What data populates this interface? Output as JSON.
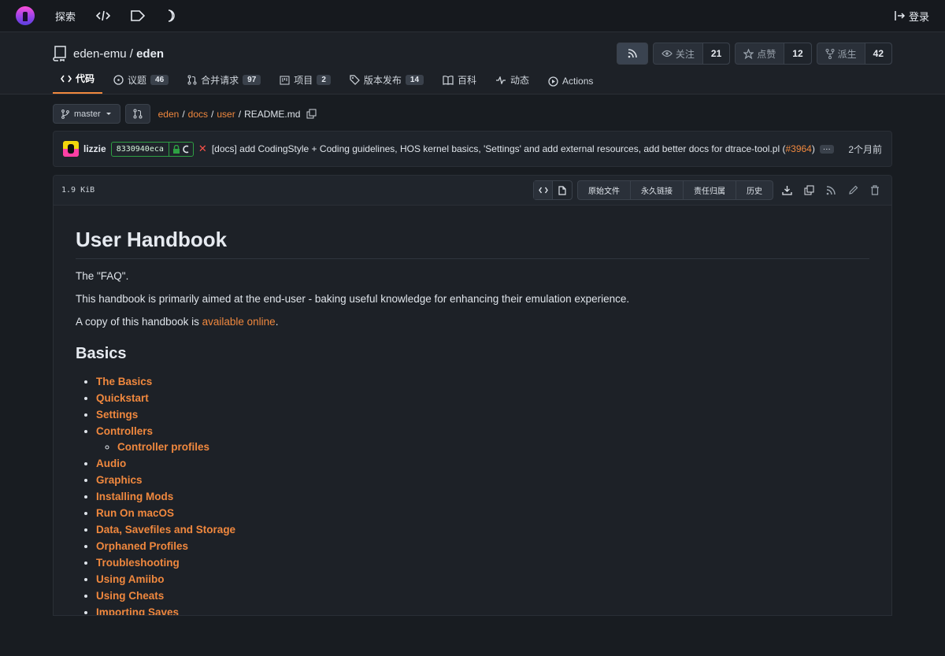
{
  "topnav": {
    "explore": "探索",
    "login": "登录"
  },
  "repo": {
    "owner": "eden-emu",
    "separator": "/",
    "name": "eden",
    "watch_label": "关注",
    "watch_count": "21",
    "star_label": "点赞",
    "star_count": "12",
    "fork_label": "派生",
    "fork_count": "42"
  },
  "tabs": [
    {
      "label": "代码",
      "badge": ""
    },
    {
      "label": "议题",
      "badge": "46"
    },
    {
      "label": "合并请求",
      "badge": "97"
    },
    {
      "label": "项目",
      "badge": "2"
    },
    {
      "label": "版本发布",
      "badge": "14"
    },
    {
      "label": "百科",
      "badge": ""
    },
    {
      "label": "动态",
      "badge": ""
    },
    {
      "label": "Actions",
      "badge": ""
    }
  ],
  "breadcrumb": {
    "branch": "master",
    "parts": [
      "eden",
      "docs",
      "user"
    ],
    "file": "README.md"
  },
  "commit": {
    "author": "lizzie",
    "sha": "8330940eca",
    "message": "[docs] add CodingStyle + Coding guidelines, HOS kernel basics, 'Settings' and add external resources, add better docs for dtrace-tool.pl (",
    "pr": "#3964",
    "message_end": ")",
    "ellipsis": "···",
    "time": "2个月前"
  },
  "file": {
    "size": "1.9 KiB",
    "buttons": [
      "原始文件",
      "永久链接",
      "责任归属",
      "历史"
    ]
  },
  "markdown": {
    "title": "User Handbook",
    "p1": "The \"FAQ\".",
    "p2": "This handbook is primarily aimed at the end-user - baking useful knowledge for enhancing their emulation experience.",
    "p3_prefix": "A copy of this handbook is ",
    "p3_link": "available online",
    "p3_suffix": ".",
    "h2": "Basics",
    "items": [
      "The Basics",
      "Quickstart",
      "Settings",
      "Controllers",
      "Audio",
      "Graphics",
      "Installing Mods",
      "Run On macOS",
      "Data, Savefiles and Storage",
      "Orphaned Profiles",
      "Troubleshooting",
      "Using Amiibo",
      "Using Cheats",
      "Importing Saves"
    ],
    "subitem": "Controller profiles"
  },
  "colors": {
    "accent": "#f0883e",
    "background": "#181c21",
    "success": "#2ea043",
    "danger": "#f85149"
  }
}
